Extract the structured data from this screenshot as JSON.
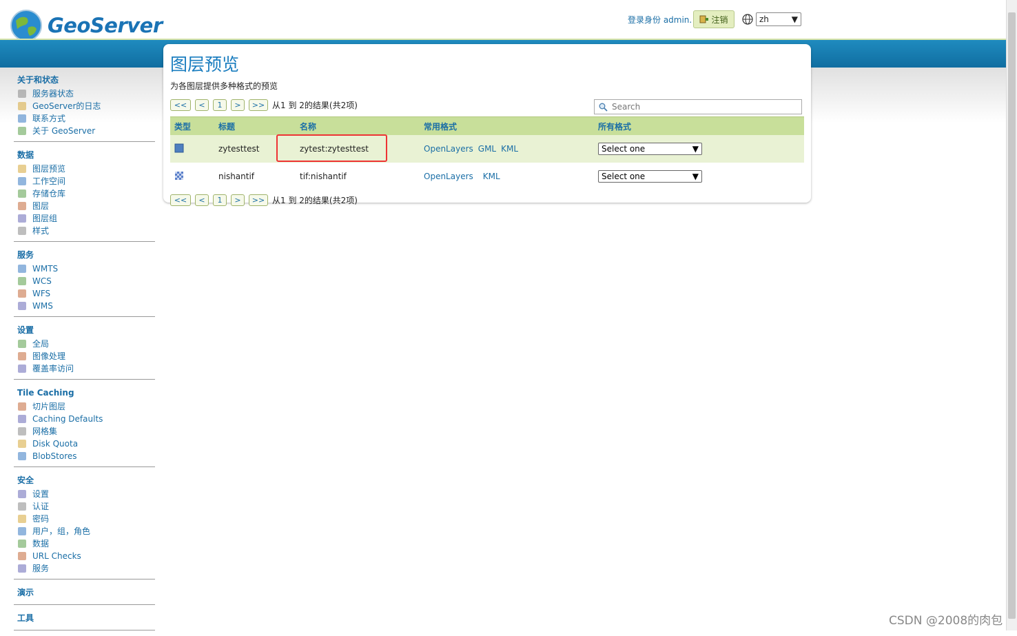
{
  "header": {
    "logo_text": "GeoServer",
    "login_text": "登录身份 admin.",
    "logout_label": "注销",
    "language_value": "zh"
  },
  "sidebar": {
    "sections": [
      {
        "title": "关于和状态",
        "items": [
          "服务器状态",
          "GeoServer的日志",
          "联系方式",
          "关于 GeoServer"
        ]
      },
      {
        "title": "数据",
        "items": [
          "图层预览",
          "工作空间",
          "存储仓库",
          "图层",
          "图层组",
          "样式"
        ]
      },
      {
        "title": "服务",
        "items": [
          "WMTS",
          "WCS",
          "WFS",
          "WMS"
        ]
      },
      {
        "title": "设置",
        "items": [
          "全局",
          "图像处理",
          "覆盖率访问"
        ]
      },
      {
        "title": "Tile Caching",
        "items": [
          "切片图层",
          "Caching Defaults",
          "网格集",
          "Disk Quota",
          "BlobStores"
        ]
      },
      {
        "title": "安全",
        "items": [
          "设置",
          "认证",
          "密码",
          "用户，组，角色",
          "数据",
          "URL Checks",
          "服务"
        ]
      },
      {
        "title": "演示",
        "items": []
      },
      {
        "title": "工具",
        "items": []
      }
    ]
  },
  "main": {
    "title": "图层预览",
    "description": "为各图层提供多种格式的预览",
    "pager": {
      "first": "<<",
      "prev": "<",
      "page": "1",
      "next": ">",
      "last": ">>",
      "summary": "从1 到 2的结果(共2项)"
    },
    "search_placeholder": "Search",
    "table": {
      "headers": [
        "类型",
        "标题",
        "名称",
        "常用格式",
        "所有格式"
      ],
      "rows": [
        {
          "title": "zytesttest",
          "name": "zytest:zytesttest",
          "formats": [
            "OpenLayers",
            "GML",
            "KML"
          ],
          "all_formats": "Select one"
        },
        {
          "title": "nishantif",
          "name": "tif:nishantif",
          "formats": [
            "OpenLayers",
            "KML"
          ],
          "all_formats": "Select one"
        }
      ]
    }
  },
  "watermark": "CSDN @2008的肉包"
}
